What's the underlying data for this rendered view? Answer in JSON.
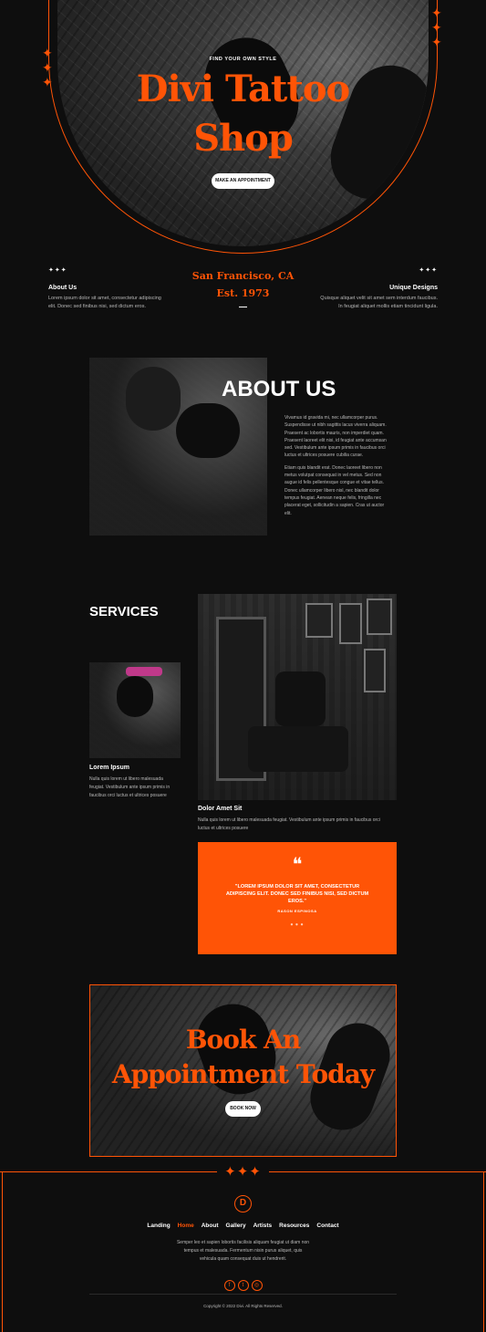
{
  "hero": {
    "eyebrow": "FIND YOUR OWN STYLE",
    "title_line1": "Divi Tattoo",
    "title_line2": "Shop",
    "button": "MAKE AN APPOINTMENT"
  },
  "info_bar": {
    "left": {
      "stars": "✦✦✦",
      "title": "About Us",
      "text1": "Lorem ipsum dolor sit amet, consectetur adipiscing",
      "text2": "elit. Donec sed finibus nisi, sed dictum eros."
    },
    "center": {
      "line1": "San Francisco, CA",
      "line2": "Est. 1973"
    },
    "right": {
      "stars": "✦✦✦",
      "title": "Unique Designs",
      "text1": "Quisque aliquet velit sit amet sem interdum faucibus.",
      "text2": "In feugiat aliquet mollis etiam tincidunt ligula."
    }
  },
  "about": {
    "title": "ABOUT US",
    "para1": [
      "Vivamus id gravida mi, nec ullamcorper purus.",
      "Suspendisse ut nibh sagittis lacus viverra aliquam.",
      "Praesent ac lobortis mauris, non imperdiet quam.",
      "Praesent laoreet elit nisi, id feugiat ante accumsan",
      "sed. Vestibulum ante ipsum primis in faucibus orci",
      "luctus et ultrices posuere cubilia curae."
    ],
    "para2": [
      "Etiam quis blandit erat. Donec laoreet libero non",
      "metus volutpat consequat in vel metus. Sed non",
      "augue id felis pellentesque congue et vitae tellus.",
      "Donec ullamcorper libero nisl, nec blandit dolor",
      "tempus feugiat. Aenean neque felis, fringilla nec",
      "placerat eget, sollicitudin a sapien. Cras ut auctor",
      "elit."
    ]
  },
  "services": {
    "title": "SERVICES",
    "card1": {
      "title": "Lorem Ipsum",
      "lines": [
        "Nulla quis lorem ut libero malesuada",
        "feugiat. Vestibulum ante ipsum primis in",
        "faucibus orci luctus et ultrices posuere"
      ]
    },
    "card2": {
      "title": "Dolor Amet Sit",
      "lines": [
        "Nulla quis lorem ut libero malesuada feugiat. Vestibulum ante ipsum primis in faucibus orci",
        "luctus et ultrices posuere"
      ]
    },
    "quote": {
      "mark": "❝",
      "lines": [
        "\"LOREM IPSUM DOLOR SIT AMET, CONSECTETUR",
        "ADIPISCING ELIT. DONEC SED FINIBUS NISI, SED DICTUM",
        "EROS.\""
      ],
      "author": "RASON ESPINOSA",
      "dots": "● ● ●"
    }
  },
  "cta": {
    "line1": "Book An",
    "line2": "Appointment Today",
    "button": "BOOK NOW"
  },
  "footer": {
    "logo": "D",
    "sparkles": "✦✦✦",
    "nav": [
      "Landing",
      "Home",
      "About",
      "Gallery",
      "Artists",
      "Resources",
      "Contact"
    ],
    "active": "Home",
    "text": [
      "Semper leo et sapien lobortis facilisis aliquam feugiat ut diam non",
      "tempus et malesuada. Fermentum nisin purus aliquet, quis",
      "vehicula quam consequat duis ut hendrerit."
    ],
    "social": [
      "f",
      "t",
      "◎"
    ],
    "copyright": "Copyright © 2022 Divi. All Rights Reserved."
  },
  "colors": {
    "accent": "#ff5406",
    "background": "#0e0e0e"
  }
}
